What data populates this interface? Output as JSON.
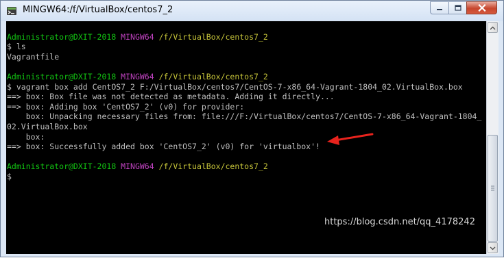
{
  "window": {
    "title": "MINGW64:/f/VirtualBox/centos7_2",
    "buttons": {
      "minimize": "minimize",
      "maximize": "maximize",
      "close": "close"
    }
  },
  "terminal": {
    "lines": [
      {
        "segments": []
      },
      {
        "segments": [
          {
            "text": "Administrator@DXIT-2018 ",
            "color": "green"
          },
          {
            "text": "MINGW64 ",
            "color": "magenta"
          },
          {
            "text": "/f/VirtualBox/centos7_2",
            "color": "yellow"
          }
        ]
      },
      {
        "segments": [
          {
            "text": "$ ls",
            "color": "default"
          }
        ]
      },
      {
        "segments": [
          {
            "text": "Vagrantfile",
            "color": "default"
          }
        ]
      },
      {
        "segments": []
      },
      {
        "segments": [
          {
            "text": "Administrator@DXIT-2018 ",
            "color": "green"
          },
          {
            "text": "MINGW64 ",
            "color": "magenta"
          },
          {
            "text": "/f/VirtualBox/centos7_2",
            "color": "yellow"
          }
        ]
      },
      {
        "segments": [
          {
            "text": "$ vagrant box add CentOS7_2 F:/VirtualBox/centos7/CentOS-7-x86_64-Vagrant-1804_02.VirtualBox.box",
            "color": "default"
          }
        ]
      },
      {
        "segments": [
          {
            "text": "==> box: Box file was not detected as metadata. Adding it directly...",
            "color": "default"
          }
        ]
      },
      {
        "segments": [
          {
            "text": "==> box: Adding box 'CentOS7_2' (v0) for provider:",
            "color": "default"
          }
        ]
      },
      {
        "segments": [
          {
            "text": "    box: Unpacking necessary files from: file:///F:/VirtualBox/centos7/CentOS-7-x86_64-Vagrant-1804_",
            "color": "default"
          }
        ]
      },
      {
        "segments": [
          {
            "text": "02.VirtualBox.box",
            "color": "default"
          }
        ]
      },
      {
        "segments": [
          {
            "text": "    box:",
            "color": "default"
          }
        ]
      },
      {
        "segments": [
          {
            "text": "==> box: Successfully added box 'CentOS7_2' (v0) for 'virtualbox'!",
            "color": "default"
          }
        ]
      },
      {
        "segments": []
      },
      {
        "segments": [
          {
            "text": "Administrator@DXIT-2018 ",
            "color": "green"
          },
          {
            "text": "MINGW64 ",
            "color": "magenta"
          },
          {
            "text": "/f/VirtualBox/centos7_2",
            "color": "yellow"
          }
        ]
      },
      {
        "segments": [
          {
            "text": "$",
            "color": "default"
          }
        ]
      }
    ],
    "colors": {
      "default": "#c0c0c0",
      "green": "#12c512",
      "magenta": "#c243c2",
      "yellow": "#c7c53a",
      "background": "#000000"
    }
  },
  "annotation": {
    "arrow_color": "#e8231d"
  },
  "watermark": "https://blog.csdn.net/qq_4178242"
}
